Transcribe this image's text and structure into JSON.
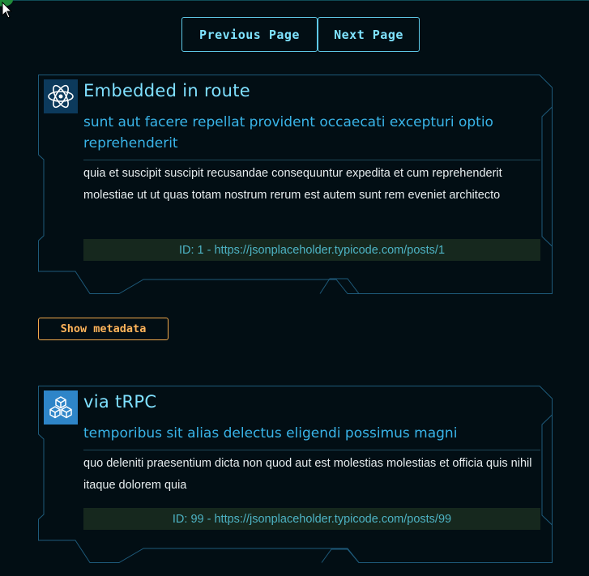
{
  "pagination": {
    "previous_label": "Previous Page",
    "next_label": "Next Page"
  },
  "posts": [
    {
      "icon": "atom-icon",
      "title": "Embedded in route",
      "subtitle": "sunt aut facere repellat provident occaecati excepturi optio reprehenderit",
      "body": "quia et suscipit suscipit recusandae consequuntur expedita et cum reprehenderit molestiae ut ut quas totam nostrum rerum est autem sunt rem eveniet architecto",
      "id_line": "ID: 1 - https://jsonplaceholder.typicode.com/posts/1"
    },
    {
      "icon": "cubes-icon",
      "title": "via tRPC",
      "subtitle": "temporibus sit alias delectus eligendi possimus magni",
      "body": "quo deleniti praesentium dicta non quod aut est molestias molestias et officia quis nihil itaque dolorem quia",
      "id_line": "ID: 99 - https://jsonplaceholder.typicode.com/posts/99"
    }
  ],
  "metadata_toggle": {
    "label": "Show metadata"
  },
  "colors": {
    "background": "#020e14",
    "frame_border": "#1e5a7a",
    "title": "#7fe0ff",
    "subtitle": "#39b4e8",
    "body_text": "#e6ecee",
    "id_bar_bg": "#16281e",
    "id_text": "#4db3c4",
    "metadata_accent": "#ffb45a"
  }
}
